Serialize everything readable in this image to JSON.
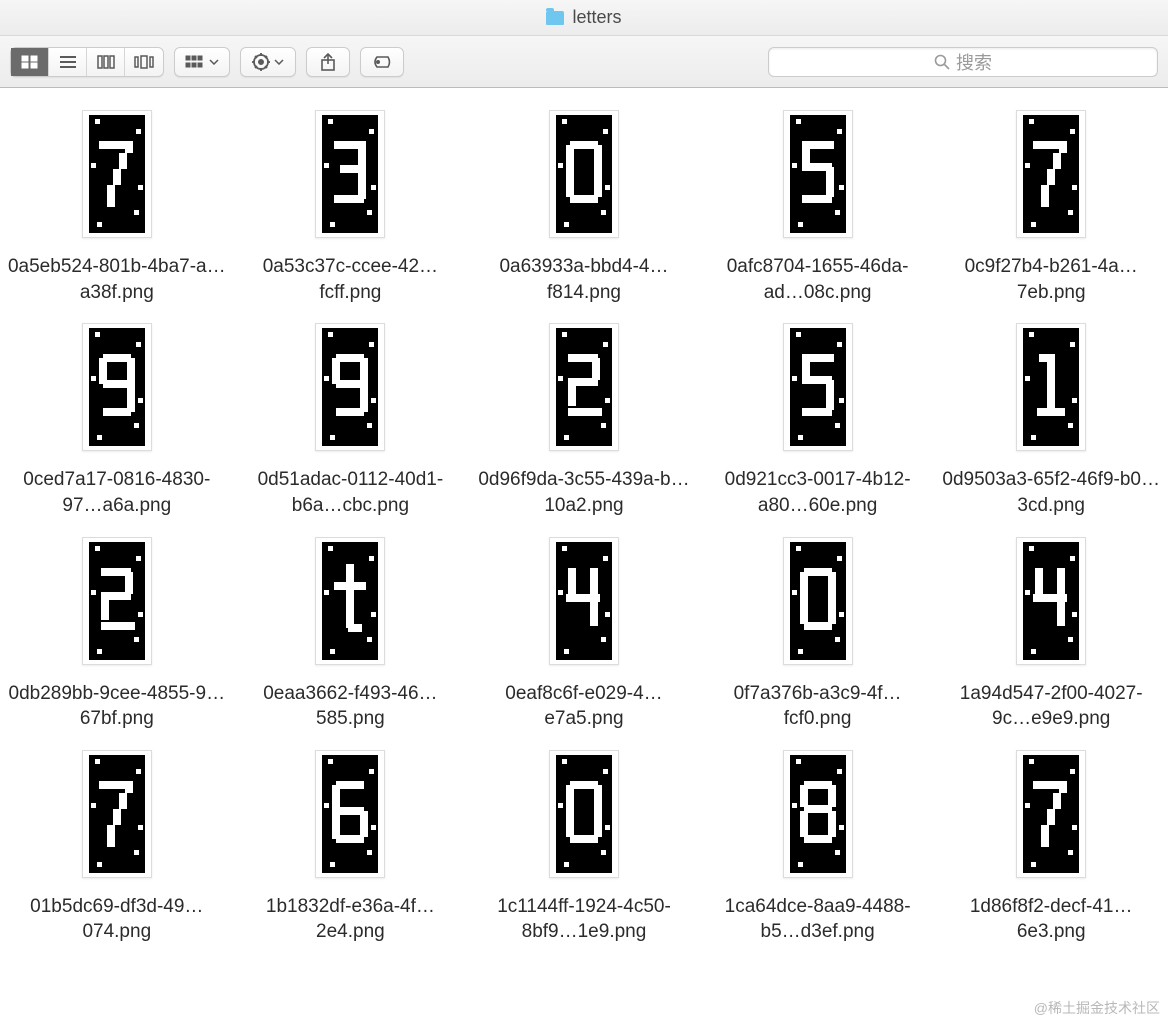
{
  "window": {
    "title": "letters"
  },
  "toolbar": {
    "search_placeholder": "搜索"
  },
  "files": [
    {
      "name": "0a5eb524-801b-4ba7-a…a38f.png",
      "glyph": "7"
    },
    {
      "name": "0a53c37c-ccee-42…fcff.png",
      "glyph": "3"
    },
    {
      "name": "0a63933a-bbd4-4…f814.png",
      "glyph": "0"
    },
    {
      "name": "0afc8704-1655-46da-ad…08c.png",
      "glyph": "5"
    },
    {
      "name": "0c9f27b4-b261-4a…7eb.png",
      "glyph": "7"
    },
    {
      "name": "0ced7a17-0816-4830-97…a6a.png",
      "glyph": "9"
    },
    {
      "name": "0d51adac-0112-40d1-b6a…cbc.png",
      "glyph": "9"
    },
    {
      "name": "0d96f9da-3c55-439a-b…10a2.png",
      "glyph": "2"
    },
    {
      "name": "0d921cc3-0017-4b12-a80…60e.png",
      "glyph": "5"
    },
    {
      "name": "0d9503a3-65f2-46f9-b0…3cd.png",
      "glyph": "1"
    },
    {
      "name": "0db289bb-9cee-4855-9…67bf.png",
      "glyph": "2"
    },
    {
      "name": "0eaa3662-f493-46…585.png",
      "glyph": "t"
    },
    {
      "name": "0eaf8c6f-e029-4…e7a5.png",
      "glyph": "4"
    },
    {
      "name": "0f7a376b-a3c9-4f…fcf0.png",
      "glyph": "0"
    },
    {
      "name": "1a94d547-2f00-4027-9c…e9e9.png",
      "glyph": "4"
    },
    {
      "name": "01b5dc69-df3d-49…074.png",
      "glyph": "7"
    },
    {
      "name": "1b1832df-e36a-4f…2e4.png",
      "glyph": "6"
    },
    {
      "name": "1c1144ff-1924-4c50-8bf9…1e9.png",
      "glyph": "0"
    },
    {
      "name": "1ca64dce-8aa9-4488-b5…d3ef.png",
      "glyph": "8"
    },
    {
      "name": "1d86f8f2-decf-41…6e3.png",
      "glyph": "7"
    }
  ],
  "watermark": "@稀土掘金技术社区"
}
